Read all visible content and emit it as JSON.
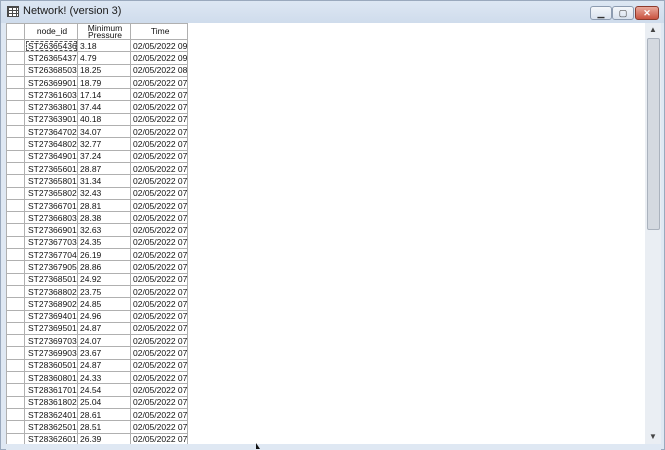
{
  "window": {
    "title": "Network! (version 3)",
    "icon": "grid-table-icon",
    "min_glyph": "▁",
    "max_glyph": "▢",
    "close_glyph": "✕"
  },
  "table": {
    "headers": {
      "node_id": "node_id",
      "pressure_line1": "Minimum",
      "pressure_line2": "Pressure",
      "time": "Time"
    },
    "rows": [
      {
        "node_id": "ST26365436",
        "pressure": "3.18",
        "time": "02/05/2022 09"
      },
      {
        "node_id": "ST26365437",
        "pressure": "4.79",
        "time": "02/05/2022 09"
      },
      {
        "node_id": "ST26368503",
        "pressure": "18.25",
        "time": "02/05/2022 08"
      },
      {
        "node_id": "ST26369901",
        "pressure": "18.79",
        "time": "02/05/2022 07"
      },
      {
        "node_id": "ST27361603",
        "pressure": "17.14",
        "time": "02/05/2022 07"
      },
      {
        "node_id": "ST27363801",
        "pressure": "37.44",
        "time": "02/05/2022 07"
      },
      {
        "node_id": "ST27363901",
        "pressure": "40.18",
        "time": "02/05/2022 07"
      },
      {
        "node_id": "ST27364702",
        "pressure": "34.07",
        "time": "02/05/2022 07"
      },
      {
        "node_id": "ST27364802",
        "pressure": "32.77",
        "time": "02/05/2022 07"
      },
      {
        "node_id": "ST27364901",
        "pressure": "37.24",
        "time": "02/05/2022 07"
      },
      {
        "node_id": "ST27365601",
        "pressure": "28.87",
        "time": "02/05/2022 07"
      },
      {
        "node_id": "ST27365801",
        "pressure": "31.34",
        "time": "02/05/2022 07"
      },
      {
        "node_id": "ST27365802",
        "pressure": "32.43",
        "time": "02/05/2022 07"
      },
      {
        "node_id": "ST27366701",
        "pressure": "28.81",
        "time": "02/05/2022 07"
      },
      {
        "node_id": "ST27366803",
        "pressure": "28.38",
        "time": "02/05/2022 07"
      },
      {
        "node_id": "ST27366901",
        "pressure": "32.63",
        "time": "02/05/2022 07"
      },
      {
        "node_id": "ST27367703",
        "pressure": "24.35",
        "time": "02/05/2022 07"
      },
      {
        "node_id": "ST27367704",
        "pressure": "26.19",
        "time": "02/05/2022 07"
      },
      {
        "node_id": "ST27367905",
        "pressure": "28.86",
        "time": "02/05/2022 07"
      },
      {
        "node_id": "ST27368501",
        "pressure": "24.92",
        "time": "02/05/2022 07"
      },
      {
        "node_id": "ST27368802",
        "pressure": "23.75",
        "time": "02/05/2022 07"
      },
      {
        "node_id": "ST27368902",
        "pressure": "24.85",
        "time": "02/05/2022 07"
      },
      {
        "node_id": "ST27369401",
        "pressure": "24.96",
        "time": "02/05/2022 07"
      },
      {
        "node_id": "ST27369501",
        "pressure": "24.87",
        "time": "02/05/2022 07"
      },
      {
        "node_id": "ST27369703",
        "pressure": "24.07",
        "time": "02/05/2022 07"
      },
      {
        "node_id": "ST27369903",
        "pressure": "23.67",
        "time": "02/05/2022 07"
      },
      {
        "node_id": "ST28360501",
        "pressure": "24.87",
        "time": "02/05/2022 07"
      },
      {
        "node_id": "ST28360801",
        "pressure": "24.33",
        "time": "02/05/2022 07"
      },
      {
        "node_id": "ST28361701",
        "pressure": "24.54",
        "time": "02/05/2022 07"
      },
      {
        "node_id": "ST28361802",
        "pressure": "25.04",
        "time": "02/05/2022 07"
      },
      {
        "node_id": "ST28362401",
        "pressure": "28.61",
        "time": "02/05/2022 07"
      },
      {
        "node_id": "ST28362501",
        "pressure": "28.51",
        "time": "02/05/2022 07"
      },
      {
        "node_id": "ST28362601",
        "pressure": "26.39",
        "time": "02/05/2022 07"
      }
    ]
  },
  "scrollbar": {
    "up_glyph": "▲",
    "down_glyph": "▼"
  }
}
